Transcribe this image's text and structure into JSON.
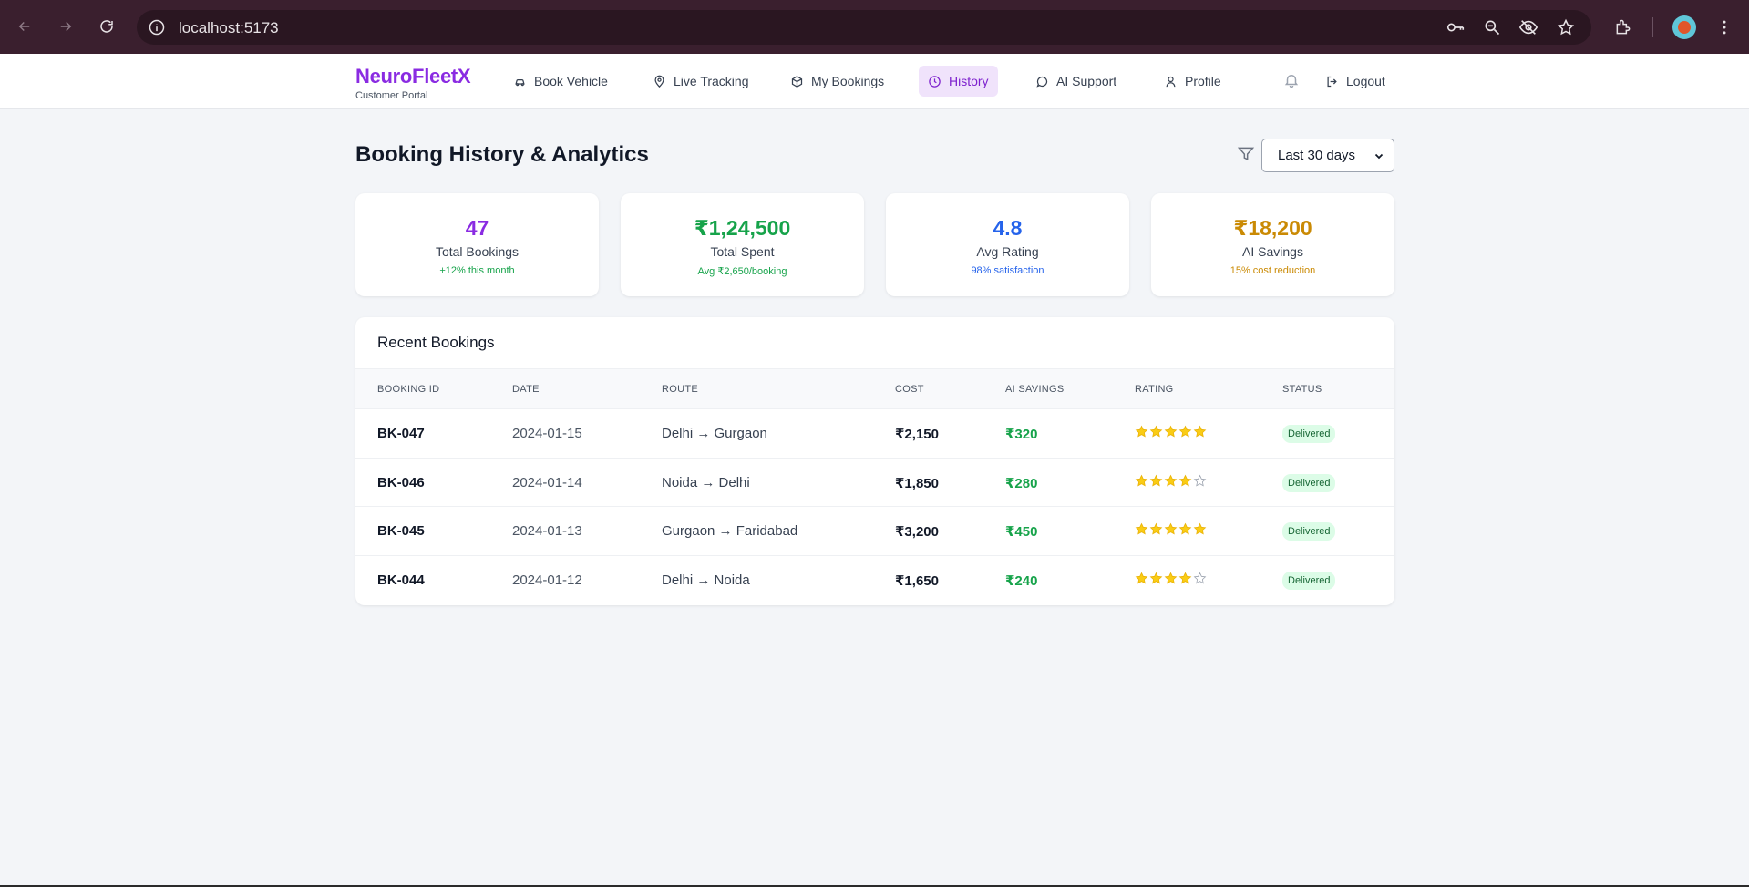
{
  "browser": {
    "url": "localhost:5173"
  },
  "brand": {
    "name": "NeuroFleetX",
    "subtitle": "Customer Portal"
  },
  "nav": {
    "items": [
      {
        "label": "Book Vehicle",
        "icon": "car-icon"
      },
      {
        "label": "Live Tracking",
        "icon": "map-pin-icon"
      },
      {
        "label": "My Bookings",
        "icon": "package-icon"
      },
      {
        "label": "History",
        "icon": "clock-icon",
        "active": true
      },
      {
        "label": "AI Support",
        "icon": "chat-icon"
      },
      {
        "label": "Profile",
        "icon": "user-icon"
      }
    ],
    "logout_label": "Logout"
  },
  "page": {
    "title": "Booking History & Analytics",
    "range_filter": "Last 30 days"
  },
  "stats": [
    {
      "value": "47",
      "label": "Total Bookings",
      "sub": "+12% this month",
      "color": "#8a2be2",
      "sub_color": "#16a34a"
    },
    {
      "value": "₹1,24,500",
      "label": "Total Spent",
      "sub": "Avg ₹2,650/booking",
      "color": "#16a34a",
      "sub_color": "#16a34a"
    },
    {
      "value": "4.8",
      "label": "Avg Rating",
      "sub": "98% satisfaction",
      "color": "#2563eb",
      "sub_color": "#2563eb"
    },
    {
      "value": "₹18,200",
      "label": "AI Savings",
      "sub": "15% cost reduction",
      "color": "#ca8a04",
      "sub_color": "#ca8a04"
    }
  ],
  "recent": {
    "title": "Recent Bookings",
    "columns": [
      "BOOKING ID",
      "DATE",
      "ROUTE",
      "COST",
      "AI SAVINGS",
      "RATING",
      "STATUS"
    ],
    "rows": [
      {
        "id": "BK-047",
        "date": "2024-01-15",
        "route": "Delhi → Gurgaon",
        "cost": "₹2,150",
        "savings": "₹320",
        "rating": 5,
        "status": "Delivered"
      },
      {
        "id": "BK-046",
        "date": "2024-01-14",
        "route": "Noida → Delhi",
        "cost": "₹1,850",
        "savings": "₹280",
        "rating": 4,
        "status": "Delivered"
      },
      {
        "id": "BK-045",
        "date": "2024-01-13",
        "route": "Gurgaon → Faridabad",
        "cost": "₹3,200",
        "savings": "₹450",
        "rating": 5,
        "status": "Delivered"
      },
      {
        "id": "BK-044",
        "date": "2024-01-12",
        "route": "Delhi → Noida",
        "cost": "₹1,650",
        "savings": "₹240",
        "rating": 4,
        "status": "Delivered"
      }
    ]
  }
}
